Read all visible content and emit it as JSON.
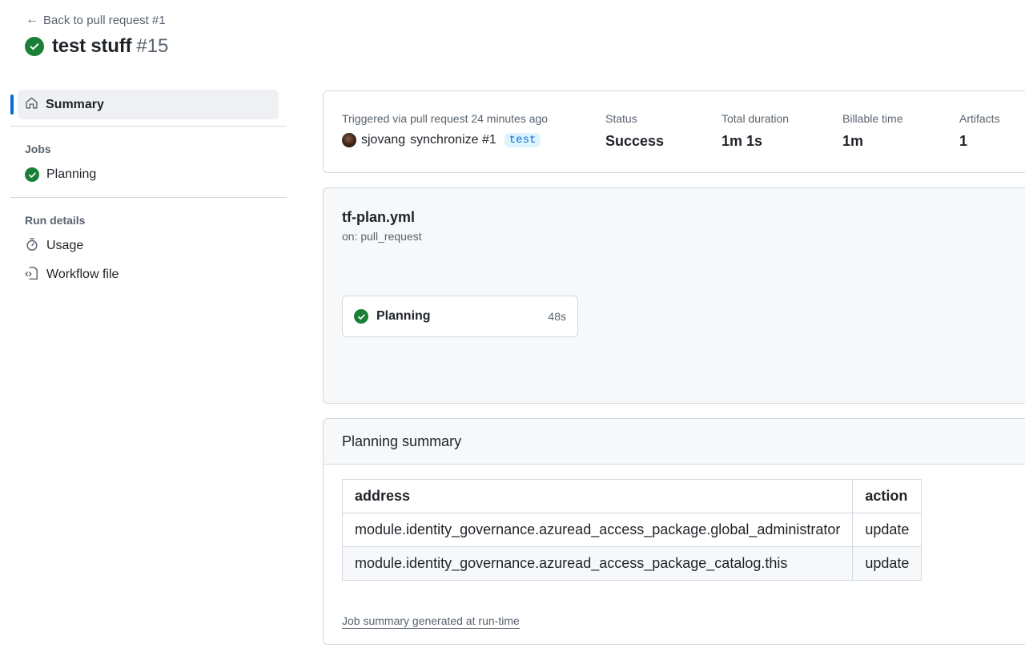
{
  "header": {
    "back_label": "Back to pull request #1",
    "title": "test stuff",
    "run_number": "#15"
  },
  "sidebar": {
    "summary_label": "Summary",
    "jobs_section": "Jobs",
    "jobs": [
      {
        "label": "Planning",
        "status": "success"
      }
    ],
    "run_details_section": "Run details",
    "usage_label": "Usage",
    "workflow_file_label": "Workflow file"
  },
  "summary": {
    "triggered_label": "Triggered via pull request 24 minutes ago",
    "actor": "sjovang",
    "event_text": "synchronize #1",
    "branch": "test",
    "status_label": "Status",
    "status_value": "Success",
    "duration_label": "Total duration",
    "duration_value": "1m 1s",
    "billable_label": "Billable time",
    "billable_value": "1m",
    "artifacts_label": "Artifacts",
    "artifacts_value": "1"
  },
  "workflow": {
    "file_name": "tf-plan.yml",
    "trigger": "on: pull_request",
    "job": {
      "name": "Planning",
      "duration": "48s"
    }
  },
  "planning_summary": {
    "title": "Planning summary",
    "columns": [
      "address",
      "action"
    ],
    "rows": [
      [
        "module.identity_governance.azuread_access_package.global_administrator",
        "update"
      ],
      [
        "module.identity_governance.azuread_access_package_catalog.this",
        "update"
      ]
    ],
    "footer": "Job summary generated at run-time"
  },
  "colors": {
    "success": "#1a7f37",
    "accent": "#0969da",
    "border": "#d1d9e0",
    "muted": "#59636e"
  }
}
